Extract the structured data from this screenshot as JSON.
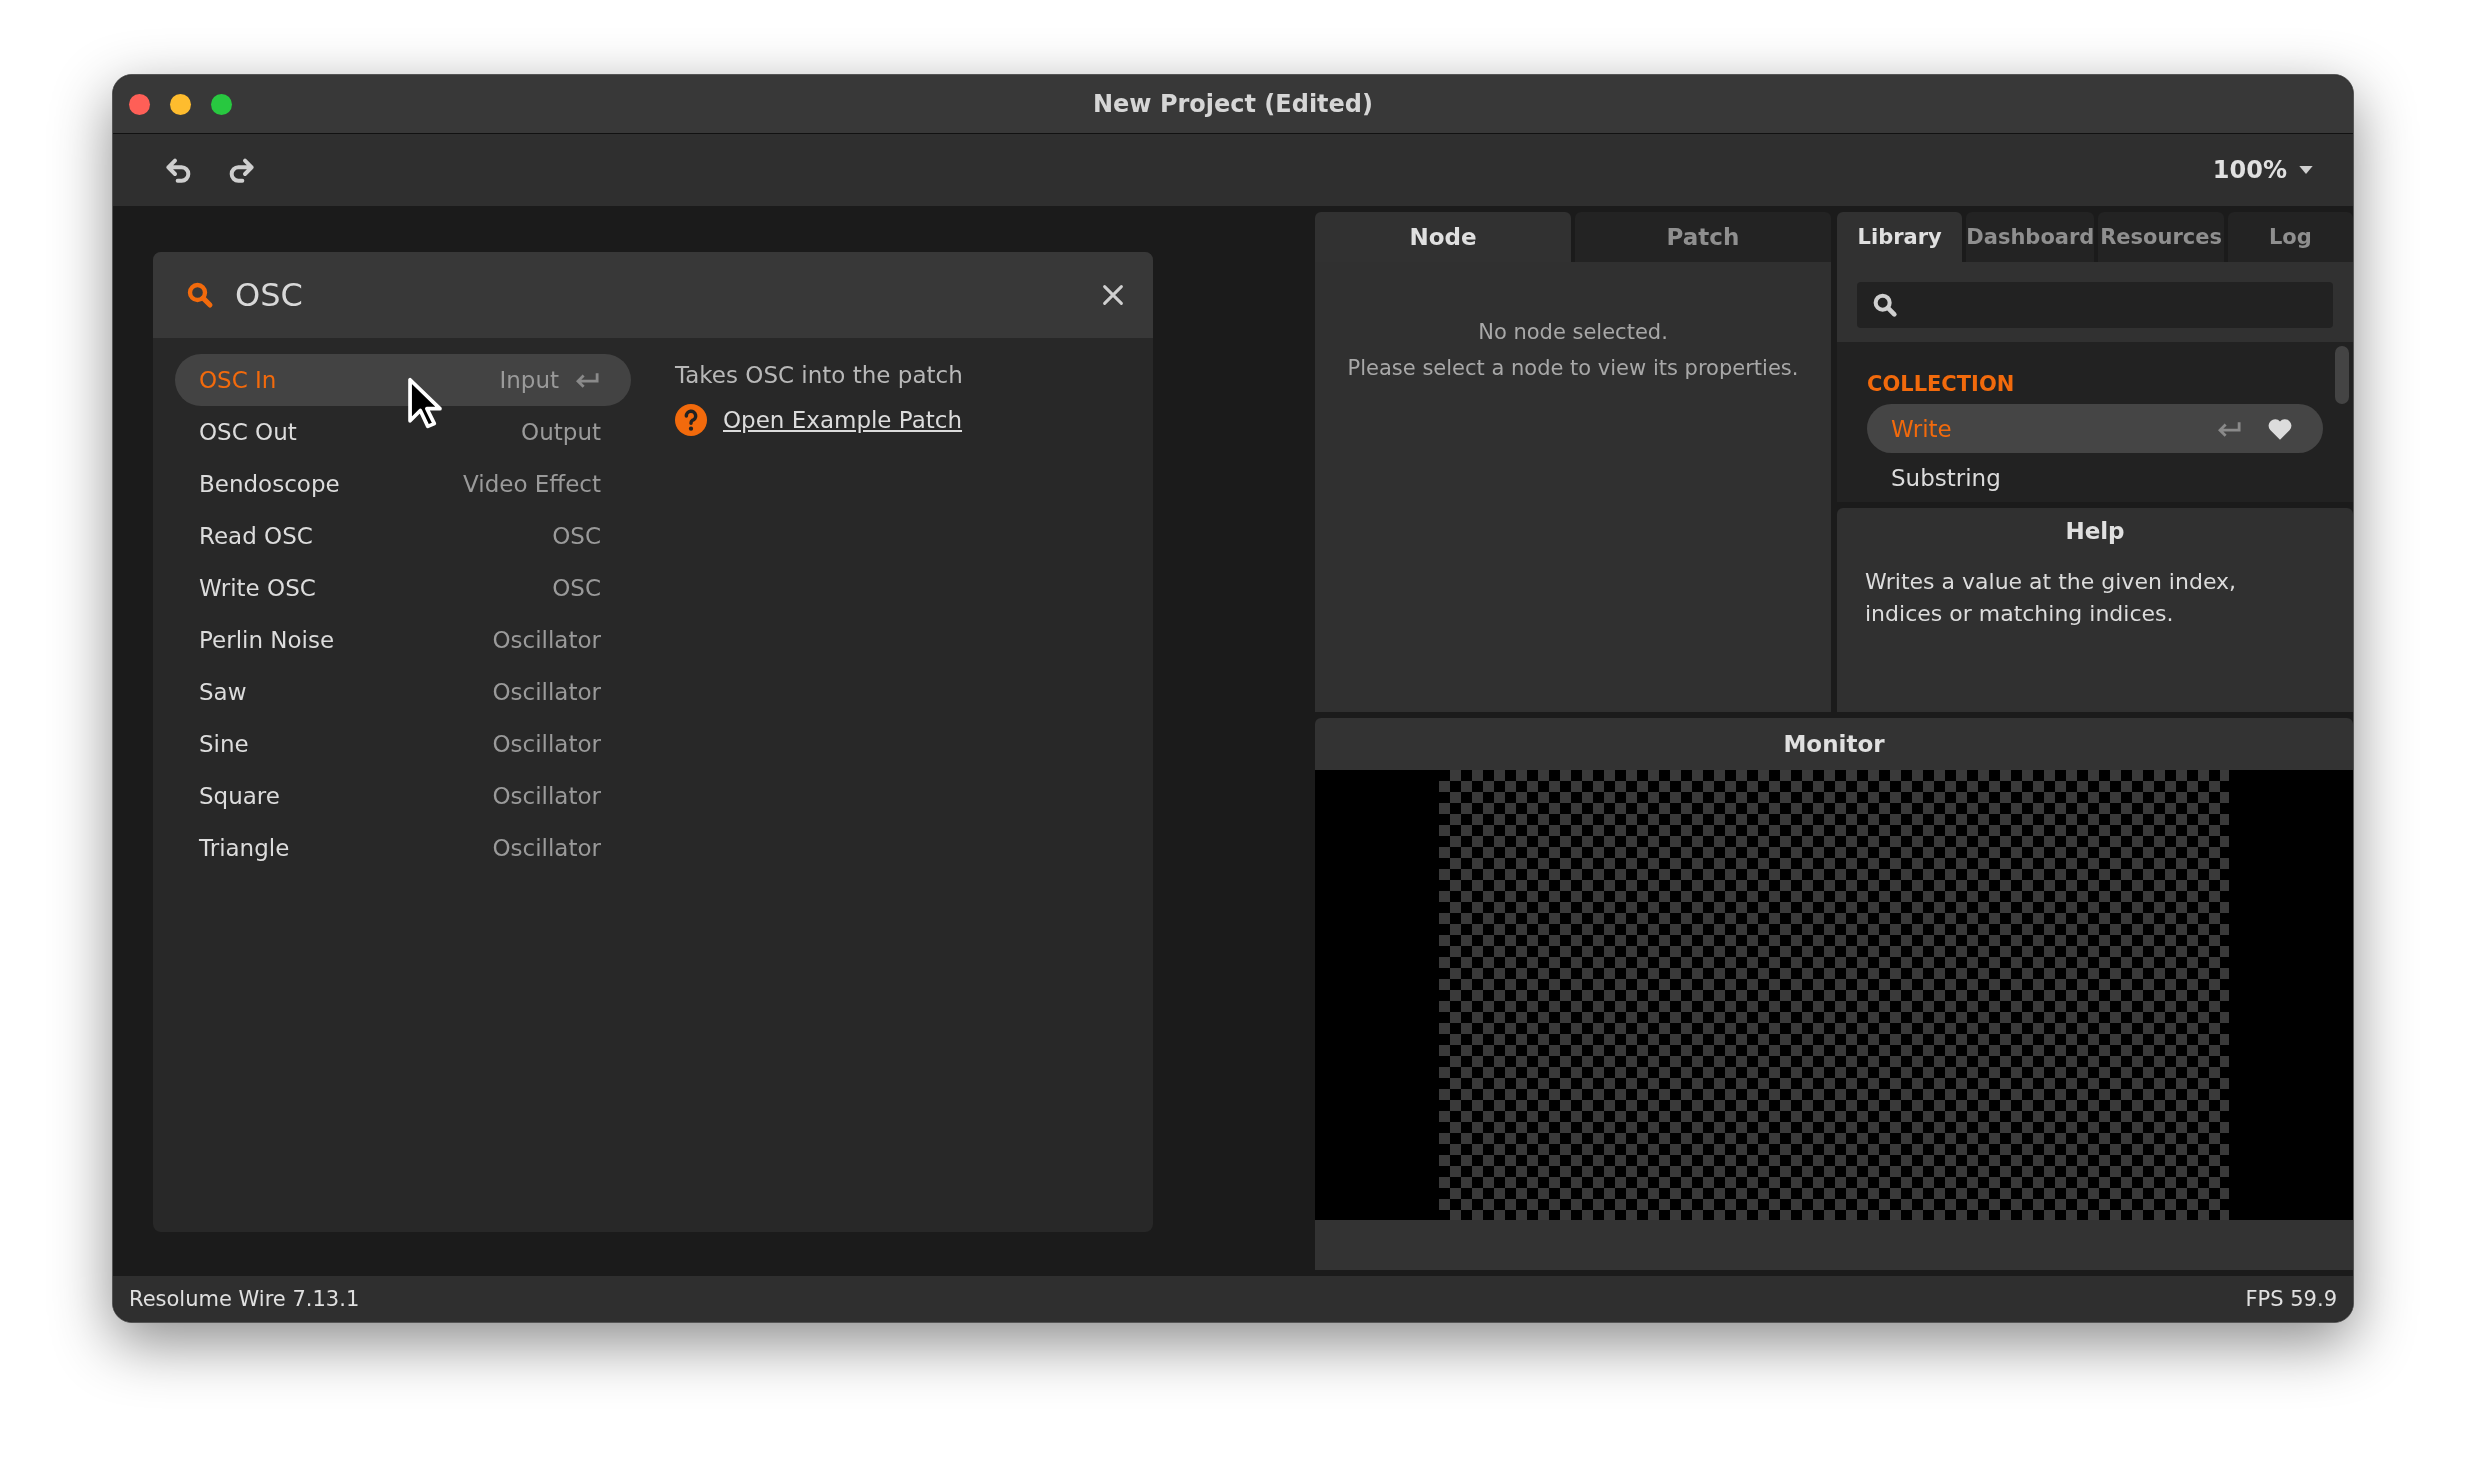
{
  "window": {
    "title": "New Project (Edited)"
  },
  "toolbar": {
    "zoom": "100%"
  },
  "search_dialog": {
    "query": "OSC",
    "results": [
      {
        "name": "OSC In",
        "category": "Input",
        "selected": true
      },
      {
        "name": "OSC Out",
        "category": "Output",
        "selected": false
      },
      {
        "name": "Bendoscope",
        "category": "Video Effect",
        "selected": false
      },
      {
        "name": "Read OSC",
        "category": "OSC",
        "selected": false
      },
      {
        "name": "Write OSC",
        "category": "OSC",
        "selected": false
      },
      {
        "name": "Perlin Noise",
        "category": "Oscillator",
        "selected": false
      },
      {
        "name": "Saw",
        "category": "Oscillator",
        "selected": false
      },
      {
        "name": "Sine",
        "category": "Oscillator",
        "selected": false
      },
      {
        "name": "Square",
        "category": "Oscillator",
        "selected": false
      },
      {
        "name": "Triangle",
        "category": "Oscillator",
        "selected": false
      }
    ],
    "description": "Takes OSC into the patch",
    "help_link": "Open Example Patch"
  },
  "inspector": {
    "tabs": [
      {
        "label": "Node",
        "selected": true
      },
      {
        "label": "Patch",
        "selected": false
      }
    ],
    "message": [
      "No node selected.",
      "Please select a node to view its properties."
    ]
  },
  "library": {
    "tabs": [
      {
        "label": "Library",
        "selected": true
      },
      {
        "label": "Dashboard",
        "selected": false
      },
      {
        "label": "Resources",
        "selected": false
      },
      {
        "label": "Log",
        "selected": false
      }
    ],
    "section": "COLLECTION",
    "items": [
      {
        "name": "Write",
        "selected": true
      },
      {
        "name": "Substring",
        "selected": false
      }
    ]
  },
  "help": {
    "title": "Help",
    "text": "Writes a value at the given index, indices or matching indices."
  },
  "monitor": {
    "title": "Monitor"
  },
  "status_bar": {
    "app": "Resolume Wire 7.13.1",
    "fps": "FPS 59.9"
  }
}
